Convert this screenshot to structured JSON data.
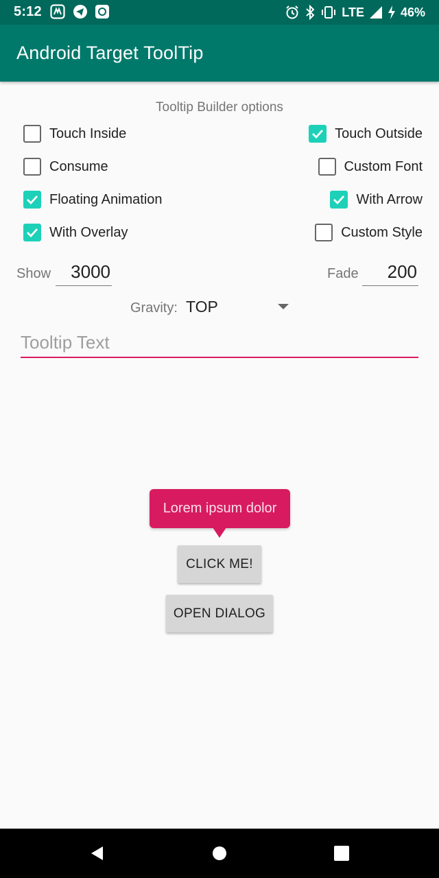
{
  "status_bar": {
    "time": "5:12",
    "network": "LTE",
    "battery": "46%",
    "left_icons": [
      "sd-card-icon",
      "telegram-icon",
      "app-icon"
    ],
    "right_icons": [
      "alarm-icon",
      "bluetooth-icon",
      "vibrate-icon",
      "signal-icon",
      "charging-icon"
    ]
  },
  "app_bar": {
    "title": "Android Target ToolTip"
  },
  "options": {
    "title": "Tooltip Builder options",
    "checkboxes": [
      {
        "label": "Touch Inside",
        "checked": false
      },
      {
        "label": "Touch Outside",
        "checked": true
      },
      {
        "label": "Consume",
        "checked": false
      },
      {
        "label": "Custom Font",
        "checked": false
      },
      {
        "label": "Floating Animation",
        "checked": true
      },
      {
        "label": "With Arrow",
        "checked": true
      },
      {
        "label": "With Overlay",
        "checked": true
      },
      {
        "label": "Custom Style",
        "checked": false
      }
    ],
    "show_label": "Show",
    "show_value": "3000",
    "fade_label": "Fade",
    "fade_value": "200",
    "gravity_label": "Gravity:",
    "gravity_value": "TOP",
    "text_placeholder": "Tooltip Text"
  },
  "tooltip": {
    "text": "Lorem ipsum dolor"
  },
  "buttons": {
    "click_me": "CLICK ME!",
    "open_dialog": "OPEN DIALOG"
  },
  "colors": {
    "status_bar": "#00695c",
    "app_bar": "#00796b",
    "accent": "#1dd1b8",
    "tooltip": "#d81b60"
  },
  "nav_bar": {
    "icons": [
      "back-icon",
      "home-icon",
      "recents-icon"
    ]
  }
}
